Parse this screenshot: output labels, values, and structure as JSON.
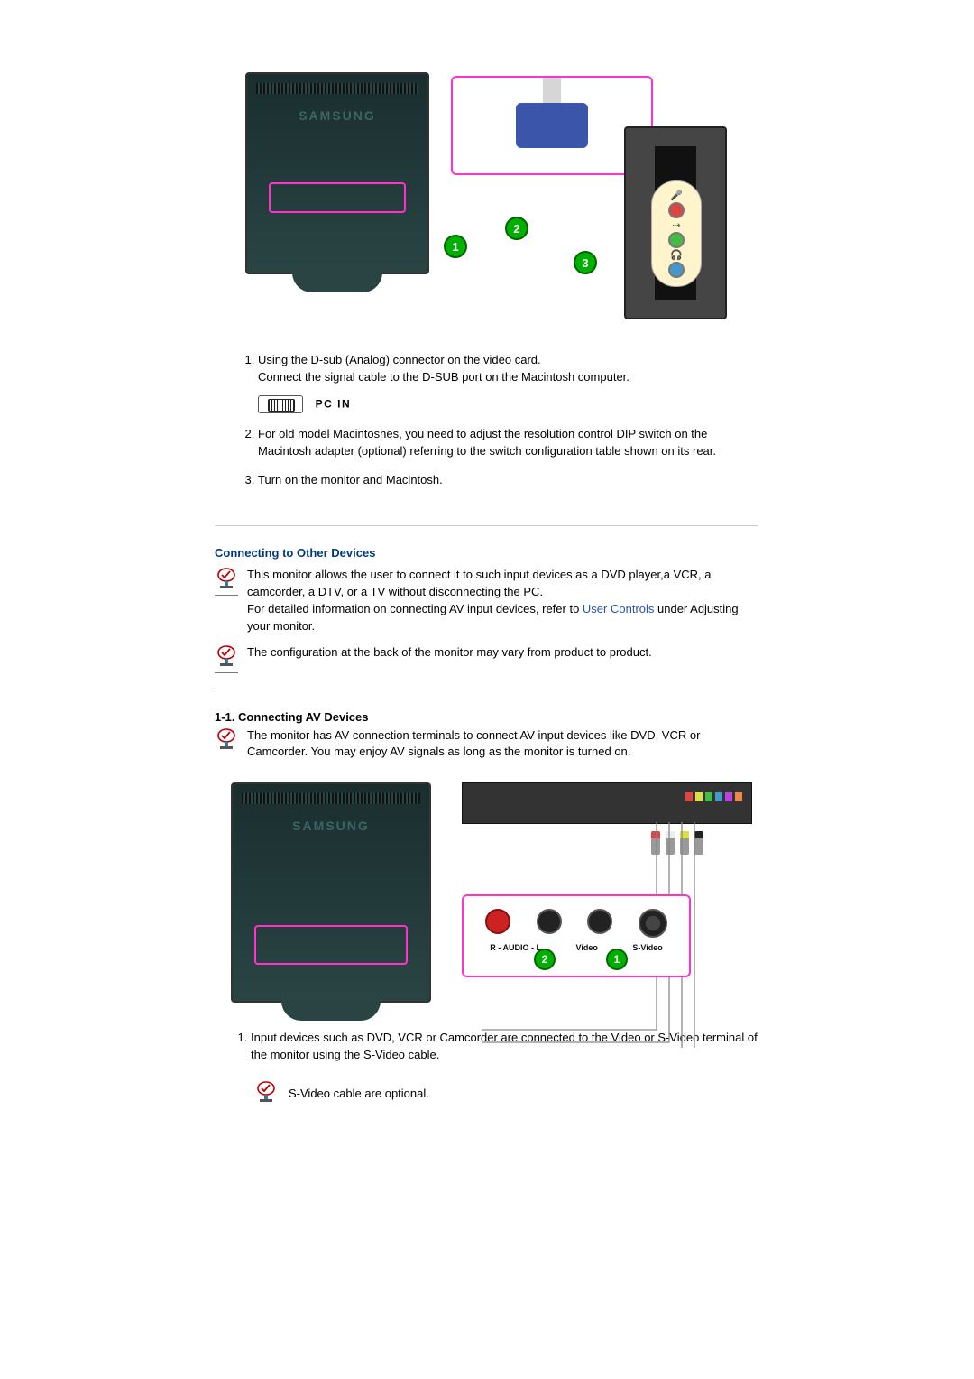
{
  "diagram1": {
    "monitor_brand": "SAMSUNG",
    "badges": {
      "b1": "1",
      "b2": "2",
      "b3": "3"
    }
  },
  "steps1": {
    "s1a": "Using the D-sub (Analog) connector on the video card.",
    "s1b": "Connect the signal cable to the D-SUB port on the Macintosh computer.",
    "port_label": "PC IN",
    "s2": "For old model Macintoshes, you need to adjust the resolution control DIP switch on the Macintosh adapter (optional) referring to the switch configuration table shown on its rear.",
    "s3": "Turn on the monitor and Macintosh."
  },
  "section_other": {
    "title": "Connecting to Other Devices",
    "note1a": "This monitor allows the user to connect it to such input devices as a DVD player,a VCR, a camcorder, a DTV, or a TV without disconnecting the PC.",
    "note1b_prefix": "For detailed information on connecting AV input devices, refer to ",
    "note1b_link": "User Controls",
    "note1b_suffix": " under Adjusting your monitor.",
    "note2": "The configuration at the back of the monitor may vary from product to product."
  },
  "section_av": {
    "title": "1-1. Connecting AV Devices",
    "intro": "The monitor has AV connection terminals to connect AV input devices like DVD, VCR or Camcorder. You may enjoy AV signals as long as the monitor is turned on."
  },
  "diagram2": {
    "monitor_brand": "SAMSUNG",
    "labels": {
      "audio_r": "R",
      "audio_c": "- AUDIO -",
      "audio_l": "L",
      "video": "Video",
      "svideo": "S-Video"
    },
    "badges": {
      "b1": "1",
      "b2": "2"
    }
  },
  "steps2": {
    "s1": "Input devices such as DVD, VCR or Camcorder are connected to the Video or S-Video terminal of the monitor using the S-Video cable."
  },
  "bottom_note": "S-Video cable are optional."
}
